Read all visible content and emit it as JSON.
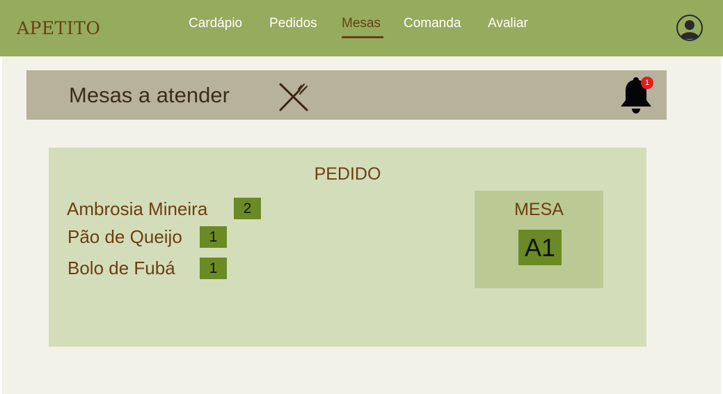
{
  "app": {
    "brand": "APETITO"
  },
  "nav": {
    "links": [
      {
        "label": "Cardápio",
        "active": false
      },
      {
        "label": "Pedidos",
        "active": false
      },
      {
        "label": "Mesas",
        "active": true
      },
      {
        "label": "Comanda",
        "active": false
      },
      {
        "label": "Avaliar",
        "active": false
      }
    ]
  },
  "header": {
    "title": "Mesas a atender",
    "icon": "fork-knife-icon",
    "notifications": {
      "icon": "bell-icon",
      "count": "1"
    }
  },
  "order": {
    "title": "PEDIDO",
    "items": [
      {
        "name": "Ambrosia Mineira",
        "quantity": "2"
      },
      {
        "name": "Pão de Queijo",
        "quantity": "1"
      },
      {
        "name": "Bolo de Fubá",
        "quantity": "1"
      }
    ],
    "table": {
      "label": "MESA",
      "number": "A1"
    }
  },
  "colors": {
    "navbar": "#95ab5e",
    "brand_text": "#6b3f12",
    "header_bar": "#b6b29b",
    "order_card": "#d4ddba",
    "table_box": "#bbc994",
    "quantity_badge": "#6b8a25",
    "notification_badge": "#e81b1b",
    "page_background": "#f3f2e8"
  }
}
